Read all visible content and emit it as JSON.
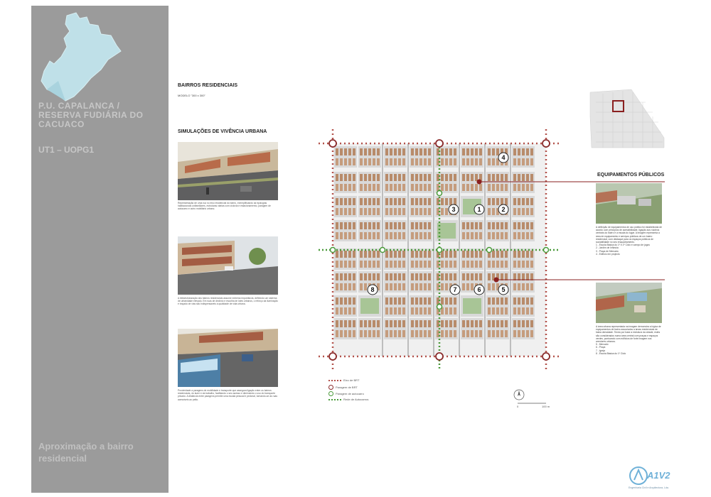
{
  "sidebar": {
    "title": "P.U. CAPALANCA / RESERVA FUDIÁRIA DO CACUACO",
    "code": "UT1 – UOPG1",
    "footer": "Aproximação a bairro residencial"
  },
  "headings": {
    "main": "BAIRROS RESIDENCIAIS",
    "model": "MODELO \"300 x 300\"",
    "simulations": "SIMULAÇÕES DE VIVÊNCIA URBANA",
    "equipment": "EQUIPAMENTOS PÚBLICOS"
  },
  "simulations": [
    {
      "caption": "Representação de uma rua no eixo residencial do bairro, exemplificando as tipologias habitacionais unifamiliares, estruturas viárias com ciclovia e estacionamento, paragem de autocarro e outro mobiliário urbano."
    },
    {
      "caption": "A infraestruturação dos bairros residenciais assume extrema importância, definindo um sistema de urbanidade elevado. Em ruas de declínio e escolha de lotes urbanos, o reforço da iluminação e traçado de vias são indispensáveis à qualidade de vida urbana."
    },
    {
      "caption": "Proximidade a paragens de mobilidade e transporte que assegura ligação entre os bairros residenciais, do lazer e da trabalho, facilitando o seu acesso e diminuindo o uso do transporte privado. A distância entre paragens permite uma escala pessoal e pedonal, tornando-se as ruas acessíveis ao peão."
    }
  ],
  "plan": {
    "markers": [
      "1",
      "2",
      "3",
      "4",
      "5",
      "6",
      "7",
      "8"
    ]
  },
  "legend": [
    {
      "label": "Eixo de BRT",
      "color": "#b3524b"
    },
    {
      "label": "Paragem de BRT",
      "color": "#8a2c2c"
    },
    {
      "label": "Paragem de autocarro",
      "color": "#4a9a3a"
    },
    {
      "label": "Rede de Autocarros",
      "color": "#4a9a3a"
    }
  ],
  "scale": {
    "zero": "0",
    "end": "100 m"
  },
  "equipment": {
    "text1": "A definição de equipamentos de uso público foi estabelecida de acordo com princípios de acessibilidade, ligação aos núcleos centrais do bairro e à escala do lugar. A imagem representa a área de equipamento e serviços públicos de um bairro residencial, com destaque para os espaços públicos de sociabilidade no seu enquadramento.",
    "list1": [
      "1 - Escola Básica do 1º e 2º Ciclo e campo de jogos",
      "2 - Jardim de Infância",
      "3 - Praça de Mercado",
      "4 - Edifício em projecto"
    ],
    "text2": "A área urbana representada na imagem demonstra a lógica de equipamentos de bairro associados a áreas residenciais de baixa densidade. Tendo por base a estrutura da cidade, estes são considerados numa área central com praças e espaços verdes, pontuando com edifícios de forte imagem nos arredores urbanos.",
    "list2": [
      "5 - Mercado",
      "6 - Praça",
      "7 - Igreja",
      "8 - Escola Básica do 1º Ciclo"
    ]
  },
  "logo": {
    "name": "A1V2",
    "tagline": "Engenharia Civil e Arquitectura, Lda."
  }
}
